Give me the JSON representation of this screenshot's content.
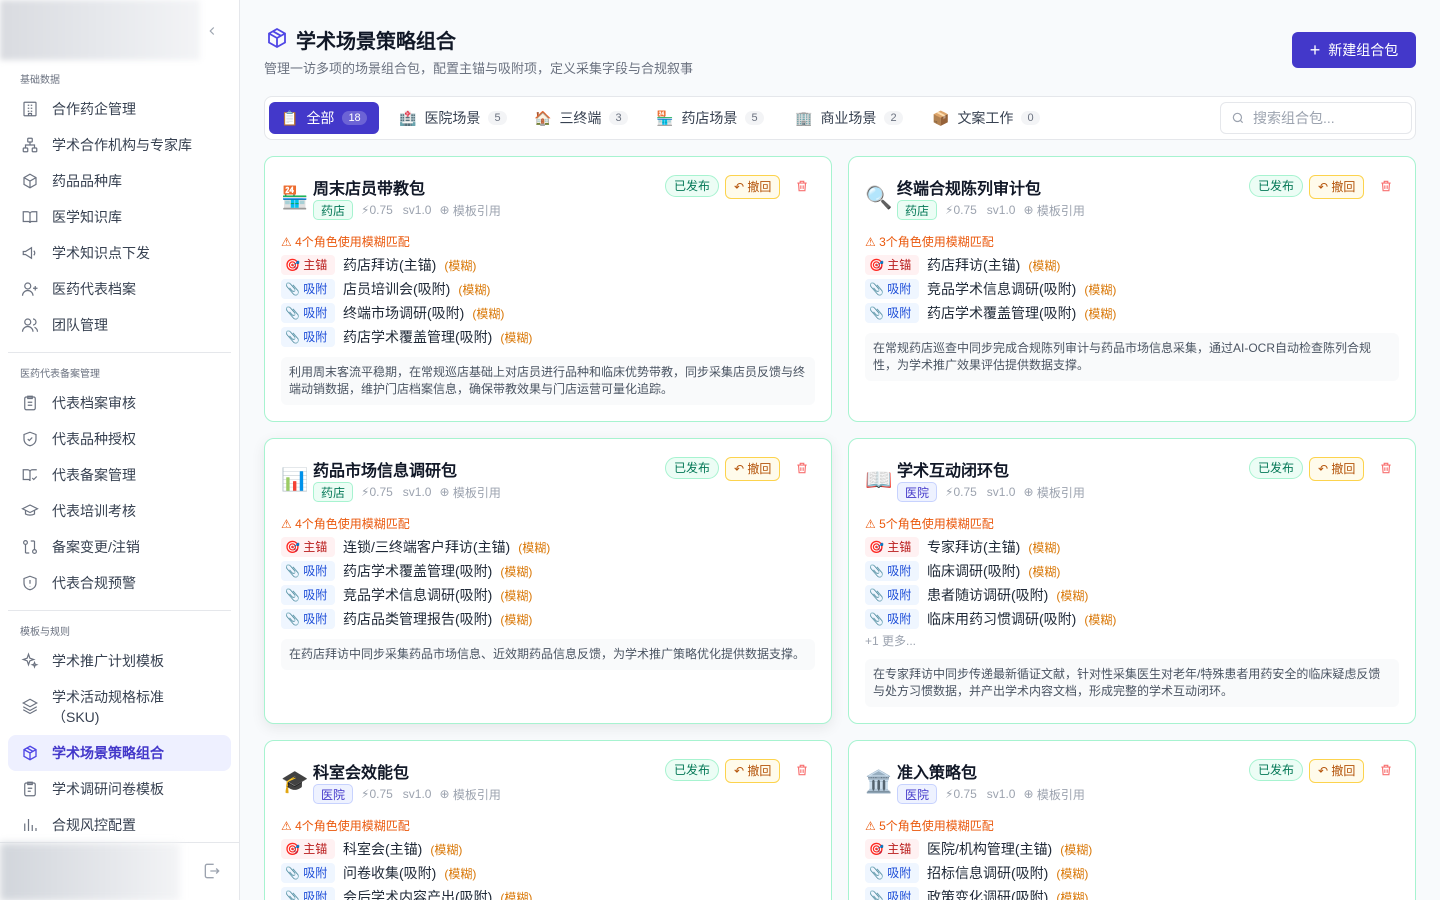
{
  "sidebar": {
    "groups": [
      {
        "title": "基础数据",
        "items": [
          {
            "label": "合作药企管理",
            "icon": "building-icon"
          },
          {
            "label": "学术合作机构与专家库",
            "icon": "network-icon"
          },
          {
            "label": "药品品种库",
            "icon": "box-icon"
          },
          {
            "label": "医学知识库",
            "icon": "book-open-icon"
          },
          {
            "label": "学术知识点下发",
            "icon": "megaphone-icon"
          },
          {
            "label": "医药代表档案",
            "icon": "user-plus-icon"
          },
          {
            "label": "团队管理",
            "icon": "users-icon"
          }
        ]
      },
      {
        "title": "医药代表备案管理",
        "items": [
          {
            "label": "代表档案审核",
            "icon": "clipboard-list-icon"
          },
          {
            "label": "代表品种授权",
            "icon": "shield-check-icon"
          },
          {
            "label": "代表备案管理",
            "icon": "book-check-icon"
          },
          {
            "label": "代表培训考核",
            "icon": "graduation-cap-icon"
          },
          {
            "label": "备案变更/注销",
            "icon": "git-compare-icon"
          },
          {
            "label": "代表合规预警",
            "icon": "shield-alert-icon"
          }
        ]
      },
      {
        "title": "模板与规则",
        "items": [
          {
            "label": "学术推广计划模板",
            "icon": "sparkles-icon"
          },
          {
            "label": "学术活动规格标准（SKU)",
            "icon": "layers-icon"
          },
          {
            "label": "学术场景策略组合",
            "icon": "package-icon",
            "active": true
          },
          {
            "label": "学术调研问卷模板",
            "icon": "clipboard-icon"
          },
          {
            "label": "合规风控配置",
            "icon": "bar-chart-icon"
          }
        ]
      }
    ]
  },
  "header": {
    "title": "学术场景策略组合",
    "subtitle": "管理一访多项的场景组合包，配置主锚与吸附项，定义采集字段与合规叙事",
    "new_button": "新建组合包"
  },
  "tabs": [
    {
      "emoji": "📋",
      "label": "全部",
      "count": "18",
      "active": true
    },
    {
      "emoji": "🏥",
      "label": "医院场景",
      "count": "5"
    },
    {
      "emoji": "🏠",
      "label": "三终端",
      "count": "3"
    },
    {
      "emoji": "🏪",
      "label": "药店场景",
      "count": "5"
    },
    {
      "emoji": "🏢",
      "label": "商业场景",
      "count": "2"
    },
    {
      "emoji": "📦",
      "label": "文案工作",
      "count": "0"
    }
  ],
  "search": {
    "placeholder": "搜索组合包..."
  },
  "card_labels": {
    "status": "已发布",
    "revoke": "撤回",
    "template_ref": "模板引用",
    "anchor": "主锚",
    "attach": "吸附",
    "fuzzy": "(模糊)"
  },
  "cards": [
    {
      "emoji": "�among",
      "name": "周末店员带教包",
      "scene": "药店",
      "score": "⚡0.75",
      "version": "sv1.0",
      "warning": "⚠ 4个角色使用模糊匹配",
      "roles": [
        {
          "type": "anchor",
          "name": "药店拜访(主锚)"
        },
        {
          "type": "attach",
          "name": "店员培训会(吸附)"
        },
        {
          "type": "attach",
          "name": "终端市场调研(吸附)"
        },
        {
          "type": "attach",
          "name": "药店学术覆盖管理(吸附)"
        }
      ],
      "description": "利用周末客流平稳期，在常规巡店基础上对店员进行品种和临床优势带教，同步采集店员反馈与终端动销数据，维护门店档案信息，确保带教效果与门店运营可量化追踪。"
    },
    {
      "emoji": "🔍",
      "name": "终端合规陈列审计包",
      "scene": "药店",
      "score": "⚡0.75",
      "version": "sv1.0",
      "warning": "⚠ 3个角色使用模糊匹配",
      "roles": [
        {
          "type": "anchor",
          "name": "药店拜访(主锚)"
        },
        {
          "type": "attach",
          "name": "竞品学术信息调研(吸附)"
        },
        {
          "type": "attach",
          "name": "药店学术覆盖管理(吸附)"
        }
      ],
      "description": "在常规药店巡查中同步完成合规陈列审计与药品市场信息采集，通过AI-OCR自动检查陈列合规性，为学术推广效果评估提供数据支撑。"
    },
    {
      "emoji": "📊",
      "name": "药品市场信息调研包",
      "scene": "药店",
      "score": "⚡0.75",
      "version": "sv1.0",
      "warning": "⚠ 4个角色使用模糊匹配",
      "roles": [
        {
          "type": "anchor",
          "name": "连锁/三终端客户拜访(主锚)"
        },
        {
          "type": "attach",
          "name": "药店学术覆盖管理(吸附)"
        },
        {
          "type": "attach",
          "name": "竞品学术信息调研(吸附)"
        },
        {
          "type": "attach",
          "name": "药店品类管理报告(吸附)"
        }
      ],
      "description": "在药店拜访中同步采集药品市场信息、近效期药品信息反馈，为学术推广策略优化提供数据支撑。"
    },
    {
      "emoji": "📖",
      "name": "学术互动闭环包",
      "scene": "医院",
      "score": "⚡0.75",
      "version": "sv1.0",
      "warning": "⚠ 5个角色使用模糊匹配",
      "roles": [
        {
          "type": "anchor",
          "name": "专家拜访(主锚)"
        },
        {
          "type": "attach",
          "name": "临床调研(吸附)"
        },
        {
          "type": "attach",
          "name": "患者随访调研(吸附)"
        },
        {
          "type": "attach",
          "name": "临床用药习惯调研(吸附)"
        }
      ],
      "more": "+1 更多...",
      "description": "在专家拜访中同步传递最新循证文献，针对性采集医生对老年/特殊患者用药安全的临床疑虑反馈与处方习惯数据，并产出学术内容文档，形成完整的学术互动闭环。"
    },
    {
      "emoji": "🎓",
      "name": "科室会效能包",
      "scene": "医院",
      "score": "⚡0.75",
      "version": "sv1.0",
      "warning": "⚠ 4个角色使用模糊匹配",
      "roles": [
        {
          "type": "anchor",
          "name": "科室会(主锚)"
        },
        {
          "type": "attach",
          "name": "问卷收集(吸附)"
        },
        {
          "type": "attach",
          "name": "会后学术内容产出(吸附)"
        }
      ],
      "description": ""
    },
    {
      "emoji": "🏛️",
      "name": "准入策略包",
      "scene": "医院",
      "score": "⚡0.75",
      "version": "sv1.0",
      "warning": "⚠ 5个角色使用模糊匹配",
      "roles": [
        {
          "type": "anchor",
          "name": "医院/机构管理(主锚)"
        },
        {
          "type": "attach",
          "name": "招标信息调研(吸附)"
        },
        {
          "type": "attach",
          "name": "政策变化调研(吸附)"
        }
      ],
      "description": ""
    }
  ]
}
